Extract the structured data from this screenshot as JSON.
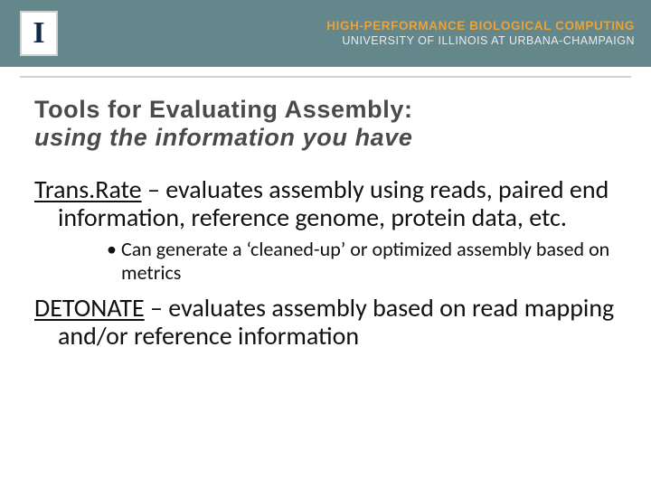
{
  "header": {
    "org_line1": "HIGH-PERFORMANCE BIOLOGICAL COMPUTING",
    "org_line2": "UNIVERSITY OF ILLINOIS AT URBANA-CHAMPAIGN",
    "logo_letter": "I"
  },
  "title": {
    "line1": "Tools for Evaluating Assembly:",
    "line2": "using the information you have"
  },
  "entries": [
    {
      "name": "Trans.Rate",
      "desc": " – evaluates assembly using reads, paired end information, reference genome, protein data, etc.",
      "sub": "Can generate a ‘cleaned-up’ or optimized assembly based on metrics"
    },
    {
      "name": "DETONATE",
      "desc": " – evaluates assembly based on read mapping and/or reference information"
    }
  ]
}
